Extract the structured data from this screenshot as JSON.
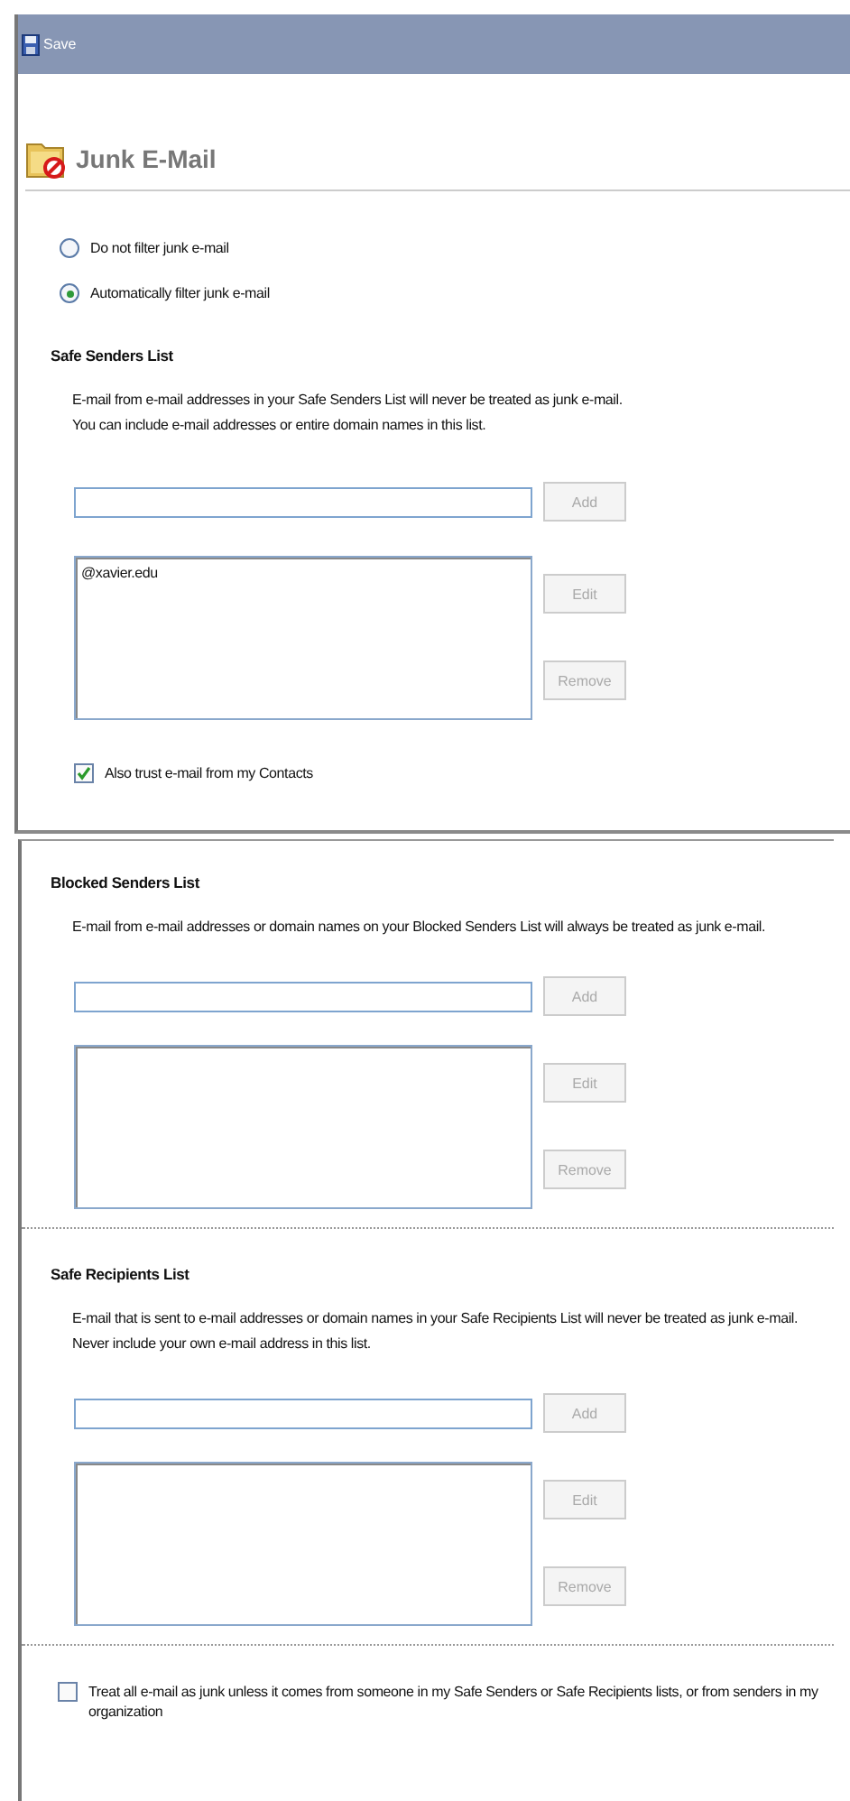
{
  "window": {
    "title": "Save"
  },
  "header": {
    "title": "Junk E-Mail"
  },
  "filter_options": [
    {
      "label": "Do not filter junk e-mail",
      "selected": false
    },
    {
      "label": "Automatically filter junk e-mail",
      "selected": true
    }
  ],
  "lists": [
    {
      "title": "Safe Senders List",
      "description": [
        "E-mail from e-mail addresses in your Safe Senders List will never be treated as junk e-mail.",
        "You can include e-mail addresses or entire domain names in this list."
      ],
      "entries": [
        "@xavier.edu"
      ],
      "buttons": [
        {
          "label": "Add",
          "disabled": true
        },
        {
          "label": "Edit",
          "disabled": true
        },
        {
          "label": "Remove",
          "disabled": true
        }
      ],
      "option": {
        "label": "Also trust e-mail from my Contacts",
        "checked": true
      }
    },
    {
      "title": "Blocked Senders List",
      "description": [
        "E-mail from e-mail addresses or domain names on your Blocked Senders List will always be treated as junk e-mail."
      ],
      "buttons": [
        {
          "label": "Add",
          "disabled": true
        },
        {
          "label": "Edit",
          "disabled": true
        },
        {
          "label": "Remove",
          "disabled": true
        }
      ]
    },
    {
      "title": "Safe Recipients List",
      "description": [
        "E-mail that is sent to e-mail addresses or domain names in your Safe Recipients List will never be treated as junk e-mail.",
        "Never include your own e-mail address in this list."
      ],
      "buttons": [
        {
          "label": "Add",
          "disabled": true
        },
        {
          "label": "Edit",
          "disabled": true
        },
        {
          "label": "Remove",
          "disabled": true
        }
      ]
    }
  ],
  "treat_all": {
    "label": "Treat all e-mail as junk unless it comes from someone in my Safe Senders or Safe Recipients lists, or from senders in my organization",
    "checked": false
  }
}
